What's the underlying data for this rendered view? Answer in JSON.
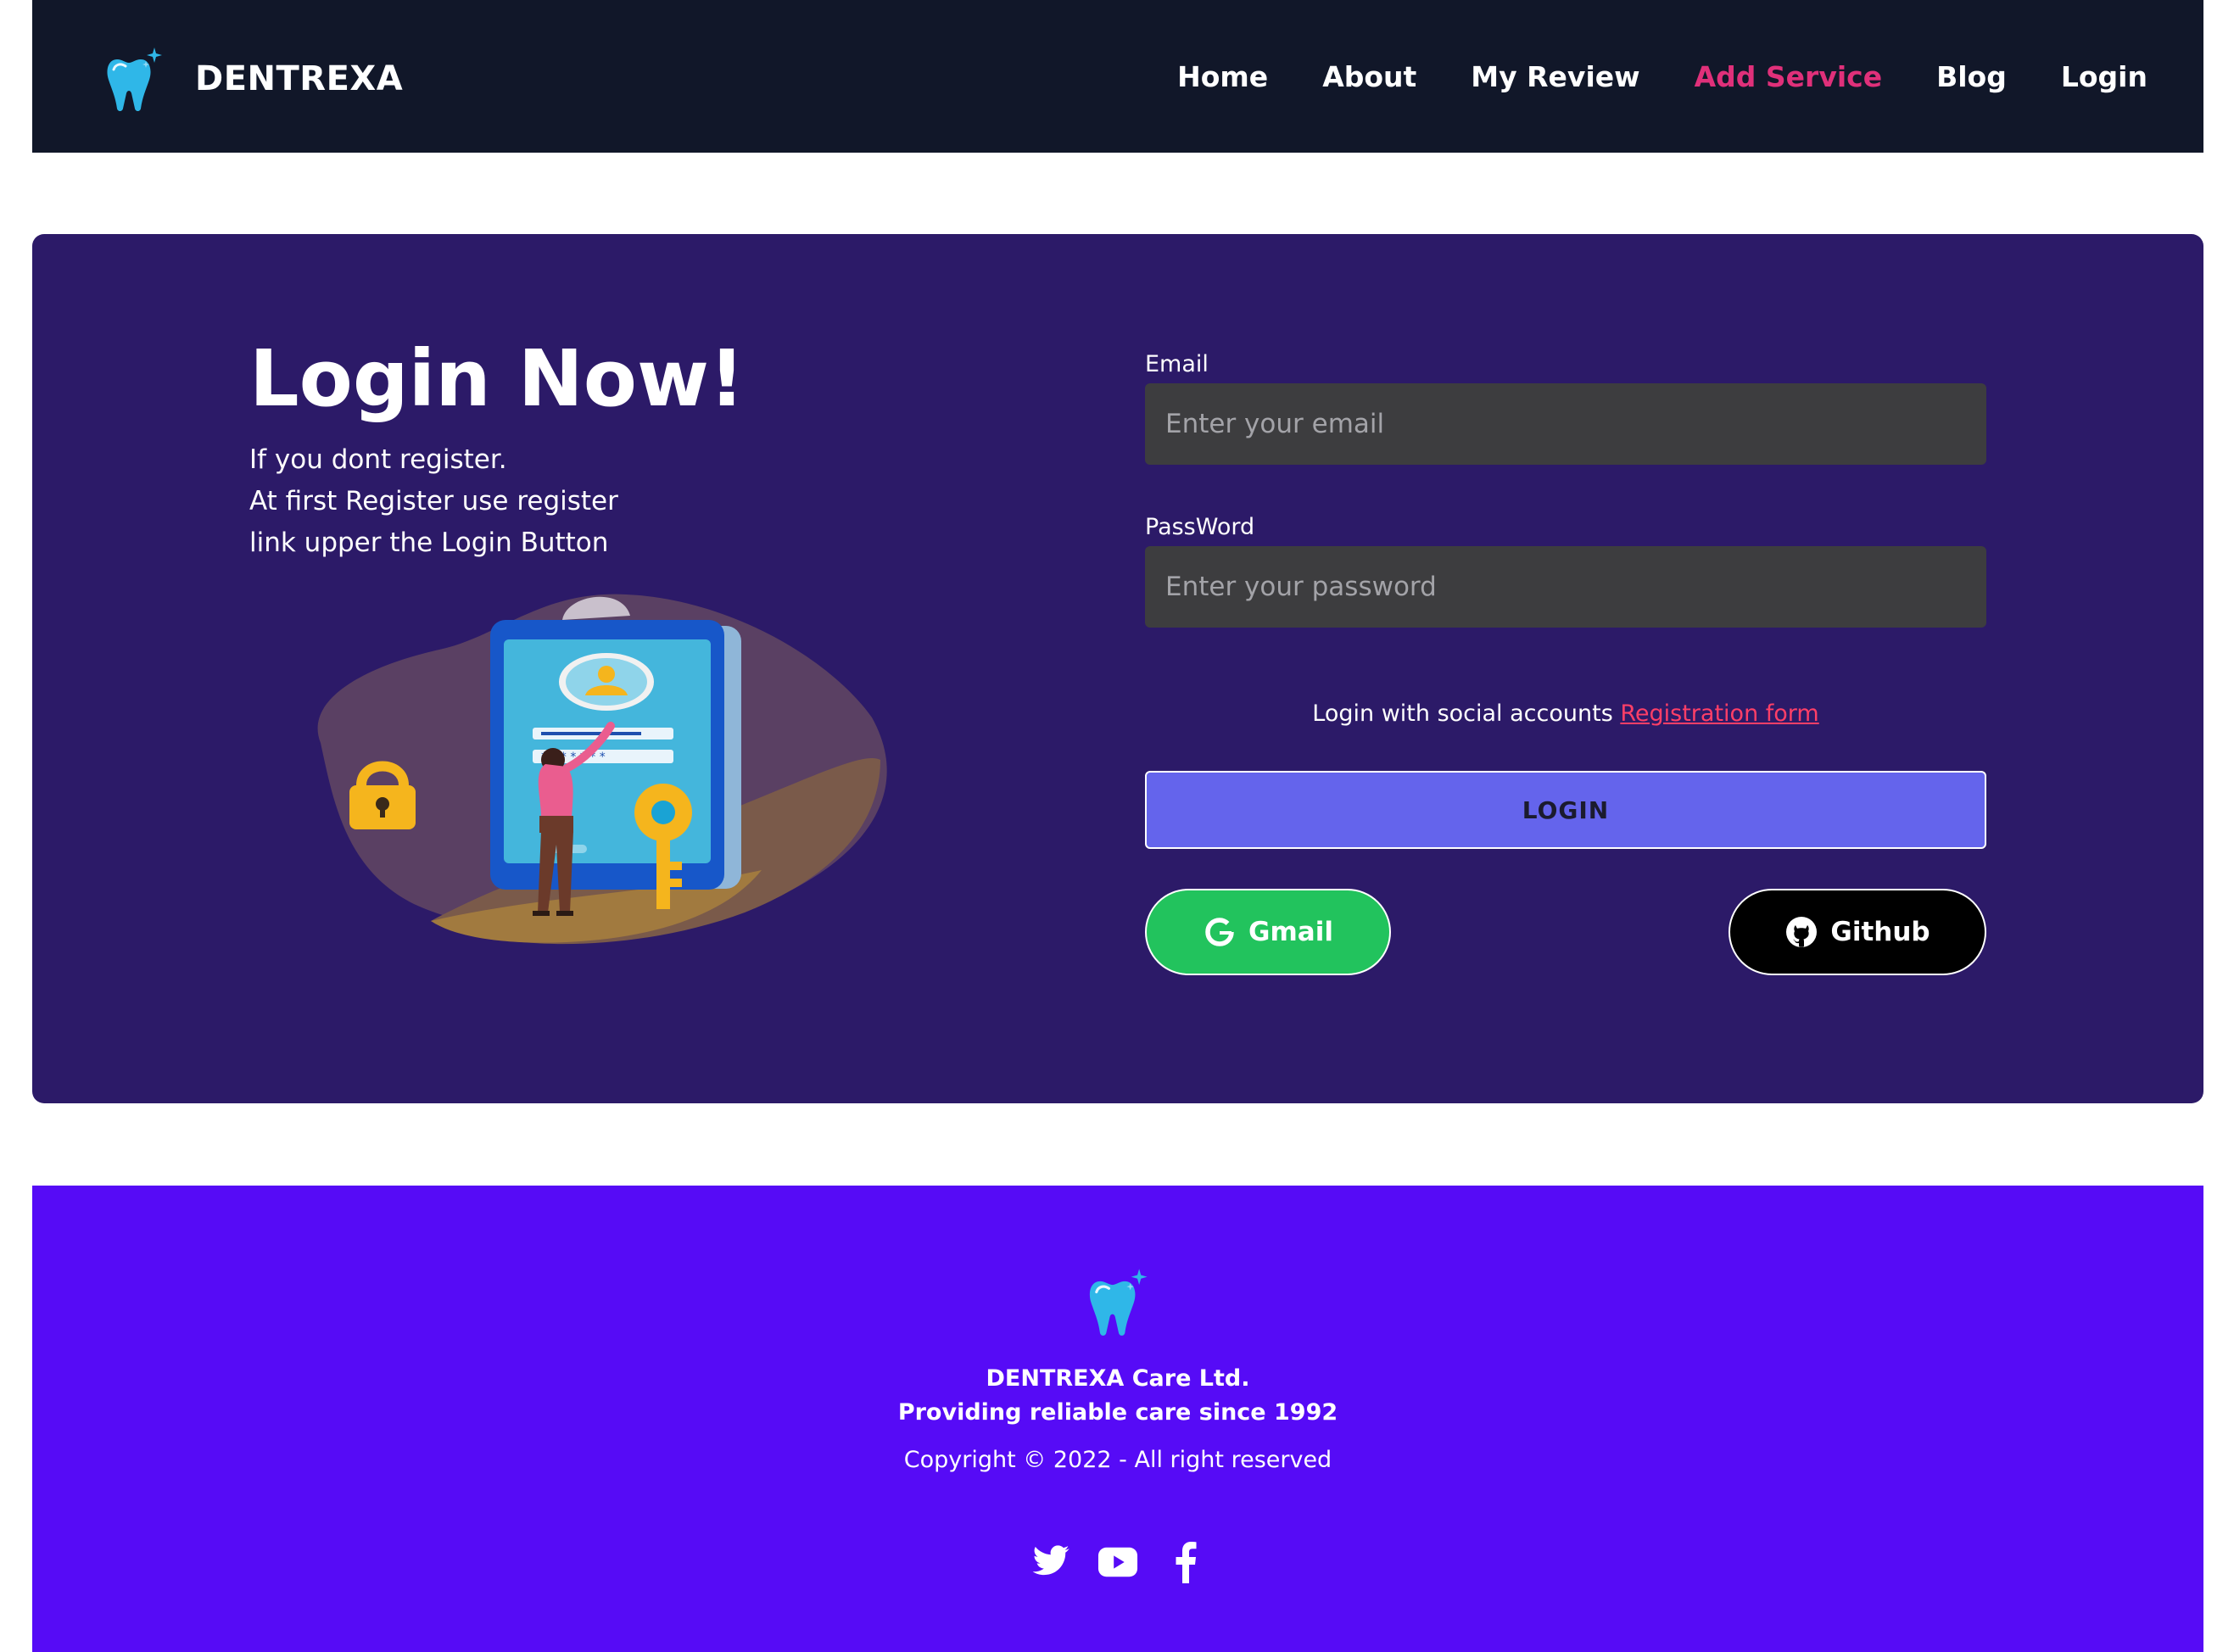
{
  "nav": {
    "brand": "DENTREXA",
    "links": [
      {
        "label": "Home"
      },
      {
        "label": "About"
      },
      {
        "label": "My Review"
      },
      {
        "label": "Add Service"
      },
      {
        "label": "Blog"
      },
      {
        "label": "Login"
      }
    ],
    "active_link": "Add Service",
    "active_color": "#e0307a"
  },
  "hero": {
    "title": "Login Now!",
    "description": [
      "If you dont register.",
      "At first Register use register",
      "link upper the Login Button"
    ],
    "illustration": "phone-login-padlock-key"
  },
  "form": {
    "email_label": "Email",
    "email_placeholder": "Enter your email",
    "email_value": "",
    "password_label": "PassWord",
    "password_placeholder": "Enter your password",
    "password_value": "",
    "social_text": "Login with social accounts",
    "registration_link": "Registration form",
    "login_button": "LOGIN",
    "gmail_button": "Gmail",
    "github_button": "Github"
  },
  "footer": {
    "company": "DENTREXA Care Ltd.",
    "tagline": "Providing reliable care since 1992",
    "copyright": "Copyright © 2022 - All right reserved",
    "social": [
      "twitter-icon",
      "youtube-icon",
      "facebook-icon"
    ]
  },
  "colors": {
    "nav_bg": "#111729",
    "hero_bg": "#2c1a68",
    "input_bg": "#3d3d3f",
    "login_button": "#6464ec",
    "gmail_button": "#22c35d",
    "github_button": "#000000",
    "footer_bg": "#560bf6",
    "link": "#ff3f67"
  }
}
